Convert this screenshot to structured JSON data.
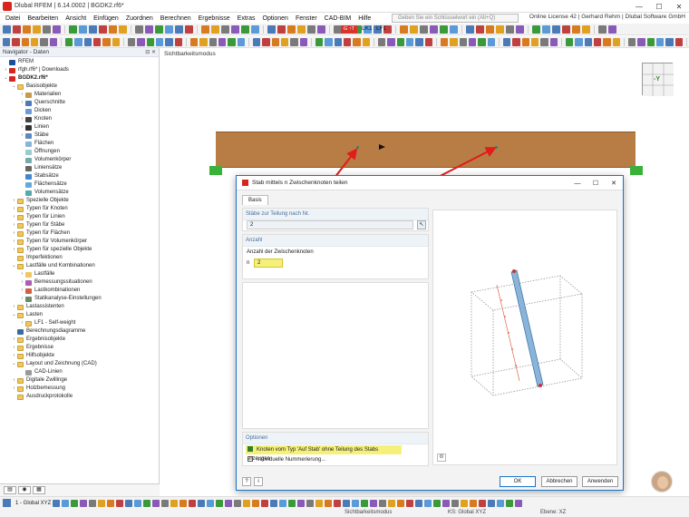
{
  "window": {
    "title": "Dlubal RFEM | 6.14.0002 | BGDK2.rf6*",
    "minimize": "—",
    "maximize": "☐",
    "close": "✕"
  },
  "menu": [
    "Datei",
    "Bearbeiten",
    "Ansicht",
    "Einfügen",
    "Zuordnen",
    "Berechnen",
    "Ergebnisse",
    "Extras",
    "Optionen",
    "Fenster",
    "CAD-BIM",
    "Hilfe"
  ],
  "search": {
    "placeholder": "Geben Sie ein Schlüsselwort ein (Alt+Q)"
  },
  "license": "Online License 42 | Gerhard Rehm | Dlubal Software GmbH",
  "toolbar": {
    "load_case_badge": "G ↑T",
    "load_case_id": "LK1",
    "load_case_name": "LF1"
  },
  "navigator": {
    "title": "Navigator - Daten",
    "items": [
      {
        "label": "RFEM",
        "level": 0,
        "arrow": "",
        "icon": "rfem"
      },
      {
        "label": "rfgh.rf6* | Downloads",
        "level": 0,
        "arrow": "›",
        "icon": "file"
      },
      {
        "label": "BGDK2.rf6*",
        "level": 0,
        "arrow": "⌄",
        "icon": "file",
        "bold": true
      },
      {
        "label": "Basisobjekte",
        "level": 1,
        "arrow": "⌄",
        "icon": "folder"
      },
      {
        "label": "Materialien",
        "level": 2,
        "arrow": "›",
        "icon": "mat"
      },
      {
        "label": "Querschnitte",
        "level": 2,
        "arrow": "›",
        "icon": "cs"
      },
      {
        "label": "Dicken",
        "level": 2,
        "arrow": "",
        "icon": "thk"
      },
      {
        "label": "Knoten",
        "level": 2,
        "arrow": "›",
        "icon": "node"
      },
      {
        "label": "Linien",
        "level": 2,
        "arrow": "›",
        "icon": "line"
      },
      {
        "label": "Stäbe",
        "level": 2,
        "arrow": "›",
        "icon": "member"
      },
      {
        "label": "Flächen",
        "level": 2,
        "arrow": "",
        "icon": "surface"
      },
      {
        "label": "Öffnungen",
        "level": 2,
        "arrow": "",
        "icon": "opening"
      },
      {
        "label": "Volumenkörper",
        "level": 2,
        "arrow": "",
        "icon": "solid"
      },
      {
        "label": "Liniensätze",
        "level": 2,
        "arrow": "",
        "icon": "lineset"
      },
      {
        "label": "Stabsätze",
        "level": 2,
        "arrow": "",
        "icon": "memberset"
      },
      {
        "label": "Flächensätze",
        "level": 2,
        "arrow": "",
        "icon": "surfaceset"
      },
      {
        "label": "Volumensätze",
        "level": 2,
        "arrow": "",
        "icon": "solidset"
      },
      {
        "label": "Spezielle Objekte",
        "level": 1,
        "arrow": "›",
        "icon": "folder"
      },
      {
        "label": "Typen für Knoten",
        "level": 1,
        "arrow": "›",
        "icon": "folder"
      },
      {
        "label": "Typen für Linien",
        "level": 1,
        "arrow": "›",
        "icon": "folder"
      },
      {
        "label": "Typen für Stäbe",
        "level": 1,
        "arrow": "›",
        "icon": "folder"
      },
      {
        "label": "Typen für Flächen",
        "level": 1,
        "arrow": "›",
        "icon": "folder"
      },
      {
        "label": "Typen für Volumenkörper",
        "level": 1,
        "arrow": "›",
        "icon": "folder"
      },
      {
        "label": "Typen für spezielle Objekte",
        "level": 1,
        "arrow": "›",
        "icon": "folder"
      },
      {
        "label": "Imperfektionen",
        "level": 1,
        "arrow": "",
        "icon": "folder"
      },
      {
        "label": "Lastfälle und Kombinationen",
        "level": 1,
        "arrow": "⌄",
        "icon": "folder"
      },
      {
        "label": "Lastfälle",
        "level": 2,
        "arrow": "›",
        "icon": "lc"
      },
      {
        "label": "Bemessungssituationen",
        "level": 2,
        "arrow": "›",
        "icon": "ds"
      },
      {
        "label": "Lastkombinationen",
        "level": 2,
        "arrow": "›",
        "icon": "co"
      },
      {
        "label": "Statikanalyse-Einstellungen",
        "level": 2,
        "arrow": "›",
        "icon": "sa"
      },
      {
        "label": "Lastassistenten",
        "level": 1,
        "arrow": "›",
        "icon": "folder"
      },
      {
        "label": "Lasten",
        "level": 1,
        "arrow": "⌄",
        "icon": "folder"
      },
      {
        "label": "LF1 - Self-weight",
        "level": 2,
        "arrow": "›",
        "icon": "folder"
      },
      {
        "label": "Berechnungsdiagramme",
        "level": 1,
        "arrow": "",
        "icon": "diag"
      },
      {
        "label": "Ergebnisobjekte",
        "level": 1,
        "arrow": "›",
        "icon": "folder"
      },
      {
        "label": "Ergebnisse",
        "level": 1,
        "arrow": "›",
        "icon": "folder"
      },
      {
        "label": "Hilfsobjekte",
        "level": 1,
        "arrow": "›",
        "icon": "folder"
      },
      {
        "label": "Layout und Zeichnung (CAD)",
        "level": 1,
        "arrow": "⌄",
        "icon": "folder"
      },
      {
        "label": "CAD-Linien",
        "level": 2,
        "arrow": "",
        "icon": "cad"
      },
      {
        "label": "Digitale Zwillinge",
        "level": 1,
        "arrow": "›",
        "icon": "folder"
      },
      {
        "label": "Holzbemessung",
        "level": 1,
        "arrow": "›",
        "icon": "folder"
      },
      {
        "label": "Ausdruckprotokolle",
        "level": 1,
        "arrow": "",
        "icon": "folder"
      }
    ]
  },
  "viewport": {
    "label": "Sichtbarkeitsmodus",
    "navcube_label": "-Y"
  },
  "dialog": {
    "title": "Stab mittels n Zwischenknoten teilen",
    "tab": "Basis",
    "section_members": "Stäbe zur Teilung nach Nr.",
    "members_value": "2",
    "section_count": "Anzahl",
    "count_label": "Anzahl der Zwischenknoten",
    "n_label": "n",
    "n_value": "2",
    "section_options": "Optionen",
    "option1": "Knoten vom Typ 'Auf Stab' ohne Teilung des Stabs erzeugen",
    "option2": "Individuelle Nummerierung...",
    "ok": "OK",
    "cancel": "Abbrechen",
    "apply": "Anwenden"
  },
  "status": {
    "coord_system": "1 - Global XYZ",
    "mode": "Sichtbarkeitsmodus",
    "ks": "KS: Global XYZ",
    "plane": "Ebene: XZ"
  },
  "colors": {
    "accent": "#1a73c7",
    "beam": "#b87d45",
    "support": "#3ab23a",
    "arrow": "#e21b1b",
    "highlight": "#f5f07a"
  }
}
